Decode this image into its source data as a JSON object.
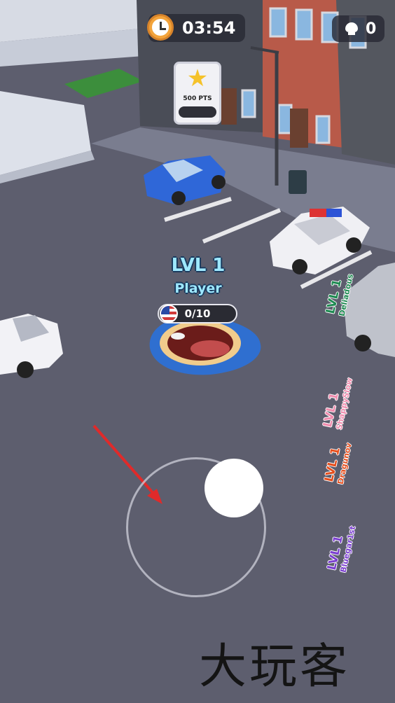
{
  "hud": {
    "timer": "03:54",
    "kills": "0",
    "clock_icon": "clock-icon",
    "skull_icon": "skull-icon"
  },
  "bonus_card": {
    "icon": "star-icon",
    "label": "500 PTS"
  },
  "player": {
    "level": "LVL 1",
    "name": "Player",
    "progress_text": "0/10",
    "progress": 0,
    "flag_icon": "us-flag-icon",
    "color": "#2f6fd0"
  },
  "enemies": [
    {
      "level": "LVL 1",
      "name": "Deliadous",
      "color": "#1f8a52"
    },
    {
      "level": "LVL 1",
      "name": "ShappySlow",
      "color": "#f08cae"
    },
    {
      "level": "LVL 1",
      "name": "Dragunov",
      "color": "#e64f1e"
    },
    {
      "level": "LVL 1",
      "name": "Bluegar1st",
      "color": "#7b3fd0"
    }
  ],
  "watermark": "大玩客"
}
